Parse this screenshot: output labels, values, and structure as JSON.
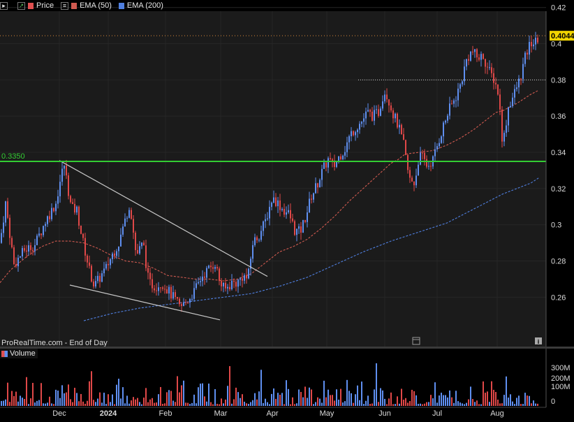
{
  "legend": {
    "price": "Price",
    "ema50": "EMA (50)",
    "ema200": "EMA (200)",
    "price_color": "#e05050",
    "ema50_color": "#d05a50",
    "ema200_color": "#4f7fe0"
  },
  "volume_legend": {
    "label": "Volume"
  },
  "watermark": "ProRealTime.com - End of Day",
  "icons": {
    "calendar": "calendar-icon",
    "info": "info-icon"
  },
  "chart_data": {
    "type": "candlestick",
    "up_color": "#5f8ff0",
    "down_color": "#e04848",
    "x_tick_labels": [
      "Dec",
      "2024",
      "Feb",
      "Mar",
      "Apr",
      "May",
      "Jun",
      "Jul",
      "Aug"
    ],
    "y_tick_labels": [
      "0.42",
      "0.4",
      "0.38",
      "0.36",
      "0.34",
      "0.32",
      "0.3",
      "0.28",
      "0.26"
    ],
    "ylim": [
      0.248,
      0.425
    ],
    "last_price": "0.4044",
    "support_level": {
      "label": "0.3350",
      "value": 0.335,
      "color": "#33cc33"
    },
    "resistance_dotted": 0.38,
    "last_price_dotted": 0.4044,
    "ema50": [
      [
        0,
        0.268
      ],
      [
        15,
        0.275
      ],
      [
        40,
        0.283
      ],
      [
        60,
        0.288
      ],
      [
        80,
        0.291
      ],
      [
        100,
        0.291
      ],
      [
        120,
        0.29
      ],
      [
        140,
        0.287
      ],
      [
        160,
        0.283
      ],
      [
        180,
        0.28
      ],
      [
        200,
        0.279
      ],
      [
        220,
        0.276
      ],
      [
        240,
        0.272
      ],
      [
        260,
        0.271
      ],
      [
        280,
        0.27
      ],
      [
        300,
        0.27
      ],
      [
        320,
        0.269
      ],
      [
        340,
        0.27
      ],
      [
        360,
        0.273
      ],
      [
        380,
        0.279
      ],
      [
        400,
        0.285
      ],
      [
        420,
        0.288
      ],
      [
        440,
        0.292
      ],
      [
        460,
        0.298
      ],
      [
        480,
        0.305
      ],
      [
        500,
        0.313
      ],
      [
        520,
        0.32
      ],
      [
        540,
        0.327
      ],
      [
        560,
        0.334
      ],
      [
        570,
        0.336
      ],
      [
        580,
        0.339
      ],
      [
        600,
        0.34
      ],
      [
        620,
        0.341
      ],
      [
        640,
        0.344
      ],
      [
        660,
        0.348
      ],
      [
        680,
        0.353
      ],
      [
        700,
        0.359
      ],
      [
        710,
        0.362
      ],
      [
        720,
        0.363
      ],
      [
        740,
        0.367
      ],
      [
        760,
        0.372
      ],
      [
        770,
        0.374
      ]
    ],
    "ema200": [
      [
        120,
        0.247
      ],
      [
        160,
        0.251
      ],
      [
        200,
        0.254
      ],
      [
        240,
        0.256
      ],
      [
        280,
        0.258
      ],
      [
        320,
        0.26
      ],
      [
        360,
        0.262
      ],
      [
        400,
        0.266
      ],
      [
        440,
        0.271
      ],
      [
        480,
        0.278
      ],
      [
        520,
        0.285
      ],
      [
        560,
        0.291
      ],
      [
        600,
        0.296
      ],
      [
        640,
        0.301
      ],
      [
        680,
        0.309
      ],
      [
        720,
        0.317
      ],
      [
        760,
        0.323
      ],
      [
        772,
        0.326
      ]
    ],
    "trend_lines": [
      {
        "name": "upper-trendline",
        "from": [
          85,
          0.3355
        ],
        "to": [
          383,
          0.2715
        ]
      },
      {
        "name": "lower-trendline",
        "from": [
          100,
          0.2667
        ],
        "to": [
          315,
          0.2475
        ]
      }
    ],
    "candle_anchors": [
      [
        0,
        0.29
      ],
      [
        8,
        0.312
      ],
      [
        20,
        0.278
      ],
      [
        35,
        0.286
      ],
      [
        50,
        0.289
      ],
      [
        65,
        0.302
      ],
      [
        80,
        0.312
      ],
      [
        88,
        0.328
      ],
      [
        92,
        0.333
      ],
      [
        102,
        0.309
      ],
      [
        110,
        0.308
      ],
      [
        118,
        0.292
      ],
      [
        128,
        0.275
      ],
      [
        135,
        0.266
      ],
      [
        145,
        0.272
      ],
      [
        152,
        0.276
      ],
      [
        160,
        0.283
      ],
      [
        170,
        0.29
      ],
      [
        178,
        0.301
      ],
      [
        186,
        0.312
      ],
      [
        195,
        0.283
      ],
      [
        205,
        0.29
      ],
      [
        213,
        0.268
      ],
      [
        222,
        0.266
      ],
      [
        232,
        0.268
      ],
      [
        240,
        0.264
      ],
      [
        250,
        0.259
      ],
      [
        258,
        0.254
      ],
      [
        268,
        0.258
      ],
      [
        278,
        0.263
      ],
      [
        290,
        0.272
      ],
      [
        300,
        0.276
      ],
      [
        308,
        0.279
      ],
      [
        315,
        0.268
      ],
      [
        322,
        0.264
      ],
      [
        332,
        0.268
      ],
      [
        340,
        0.268
      ],
      [
        348,
        0.272
      ],
      [
        355,
        0.27
      ],
      [
        362,
        0.29
      ],
      [
        372,
        0.295
      ],
      [
        380,
        0.302
      ],
      [
        390,
        0.315
      ],
      [
        398,
        0.312
      ],
      [
        406,
        0.308
      ],
      [
        414,
        0.306
      ],
      [
        422,
        0.297
      ],
      [
        430,
        0.296
      ],
      [
        438,
        0.305
      ],
      [
        446,
        0.316
      ],
      [
        454,
        0.322
      ],
      [
        462,
        0.33
      ],
      [
        470,
        0.336
      ],
      [
        478,
        0.332
      ],
      [
        486,
        0.338
      ],
      [
        494,
        0.342
      ],
      [
        502,
        0.35
      ],
      [
        510,
        0.354
      ],
      [
        518,
        0.357
      ],
      [
        526,
        0.362
      ],
      [
        534,
        0.36
      ],
      [
        542,
        0.362
      ],
      [
        550,
        0.374
      ],
      [
        556,
        0.37
      ],
      [
        562,
        0.362
      ],
      [
        570,
        0.355
      ],
      [
        578,
        0.344
      ],
      [
        586,
        0.325
      ],
      [
        594,
        0.323
      ],
      [
        600,
        0.338
      ],
      [
        606,
        0.337
      ],
      [
        612,
        0.332
      ],
      [
        620,
        0.336
      ],
      [
        628,
        0.346
      ],
      [
        636,
        0.356
      ],
      [
        644,
        0.364
      ],
      [
        652,
        0.37
      ],
      [
        660,
        0.378
      ],
      [
        668,
        0.391
      ],
      [
        676,
        0.396
      ],
      [
        684,
        0.392
      ],
      [
        692,
        0.393
      ],
      [
        700,
        0.385
      ],
      [
        708,
        0.38
      ],
      [
        714,
        0.372
      ],
      [
        720,
        0.344
      ],
      [
        728,
        0.365
      ],
      [
        736,
        0.372
      ],
      [
        744,
        0.38
      ],
      [
        752,
        0.392
      ],
      [
        760,
        0.401
      ],
      [
        766,
        0.4
      ],
      [
        772,
        0.404
      ]
    ],
    "volume": {
      "y_tick_labels": [
        "300M",
        "200M",
        "100M",
        "0"
      ],
      "ylim": [
        0,
        320
      ]
    }
  }
}
